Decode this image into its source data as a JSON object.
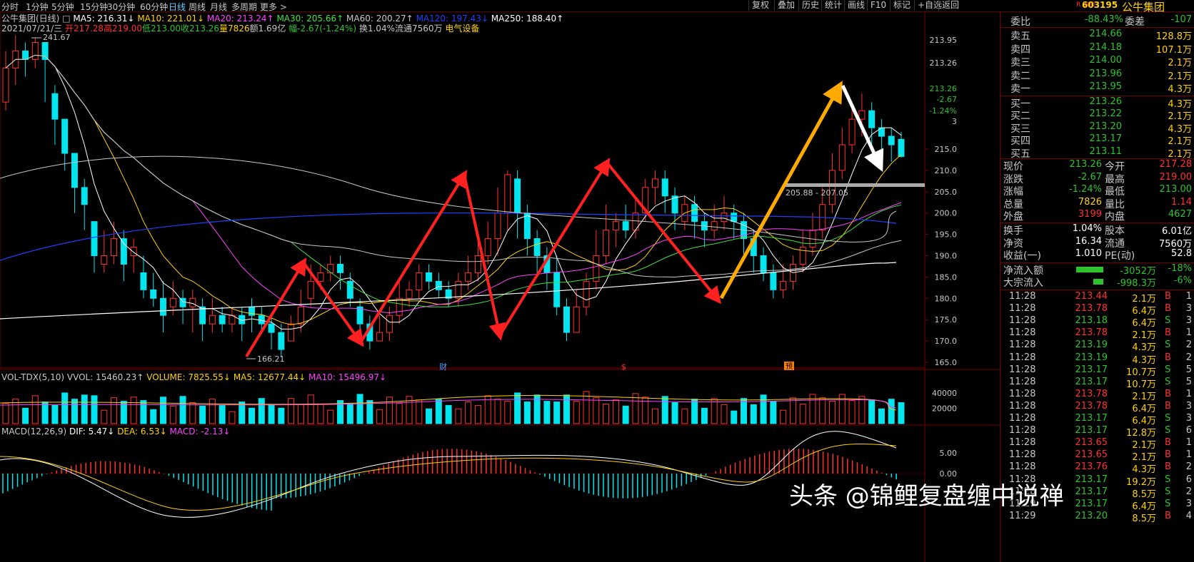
{
  "periods": [
    "分时",
    "1分钟",
    "5分钟",
    "15分钟",
    "30分钟",
    "60分钟",
    "日线",
    "周线",
    "月线",
    "多周期",
    "更多 >"
  ],
  "active_period": "日线",
  "top_buttons": [
    "复权",
    "叠加",
    "历史",
    "统计",
    "画线",
    "F10",
    "标记",
    "+自选",
    "返回"
  ],
  "info": {
    "title": "公牛集团(日线)",
    "ma5": "MA5: 216.31↓",
    "ma10": "MA10: 221.01↓",
    "ma20": "MA20: 213.24↑",
    "ma30": "MA30: 205.66↑",
    "ma60": "MA60: 200.27↑",
    "ma120": "MA120: 197.43↓",
    "ma250": "MA250: 188.40↑",
    "date": "2021/07/21/三",
    "open": "开217.28",
    "high": "高219.00",
    "low": "低213.00",
    "close": "收213.26",
    "vol": "量7826",
    "amount": "额1.69亿",
    "change": "幅-2.67(-1.24%)",
    "turnover": "换1.04%",
    "float": "流通7560万",
    "sector": "电气设备"
  },
  "price_axis": [
    "213.95",
    "213.26",
    "213.26",
    "-2.67",
    "-1.24%",
    "215.0",
    "210.0",
    "205.0",
    "200.0",
    "195.0",
    "190.0",
    "185.0",
    "180.0",
    "175.0",
    "170.0",
    "165.0"
  ],
  "annotations": {
    "high": "241.67",
    "low": "166.21",
    "zone": "205.88 - 207.05",
    "mark_cai": "财",
    "mark_s": "$",
    "mark_yu": "预"
  },
  "vol_info": {
    "title": "VOL-TDX(5,10)",
    "vvol": "VVOL: 15460.23↑",
    "volume": "VOLUME: 7825.55↓",
    "ma5": "MA5: 12677.44↓",
    "ma10": "MA10: 15496.97↓"
  },
  "vol_axis": [
    "40000",
    "20000"
  ],
  "macd_info": {
    "title": "MACD(12,26,9)",
    "dif": "DIF: 5.47↓",
    "dea": "DEA: 6.53↓",
    "macd": "MACD: -2.13↓"
  },
  "macd_axis": [
    "5.00",
    "0.00"
  ],
  "stock": {
    "code": "603195",
    "name": "公牛集团",
    "badge": "R 300"
  },
  "weibi": {
    "label1": "委比",
    "v1": "-88.43%",
    "label2": "委差",
    "v2": "-107"
  },
  "asks": [
    {
      "label": "卖五",
      "price": "214.66",
      "vol": "128.8万"
    },
    {
      "label": "卖四",
      "price": "214.18",
      "vol": "107.1万"
    },
    {
      "label": "卖三",
      "price": "214.00",
      "vol": "2.1万"
    },
    {
      "label": "卖二",
      "price": "213.96",
      "vol": "2.1万"
    },
    {
      "label": "卖一",
      "price": "213.95",
      "vol": "4.3万"
    }
  ],
  "bids": [
    {
      "label": "买一",
      "price": "213.26",
      "vol": "4.3万"
    },
    {
      "label": "买二",
      "price": "213.22",
      "vol": "2.1万"
    },
    {
      "label": "买三",
      "price": "213.20",
      "vol": "4.3万"
    },
    {
      "label": "买四",
      "price": "213.17",
      "vol": "2.1万"
    },
    {
      "label": "买五",
      "price": "213.11",
      "vol": "2.1万"
    }
  ],
  "quote": [
    {
      "l1": "现价",
      "v1": "213.26",
      "c1": "#2dc32d",
      "l2": "今开",
      "v2": "217.28",
      "c2": "#ff3030"
    },
    {
      "l1": "涨跌",
      "v1": "-2.67",
      "c1": "#2dc32d",
      "l2": "最高",
      "v2": "219.00",
      "c2": "#ff3030"
    },
    {
      "l1": "涨幅",
      "v1": "-1.24%",
      "c1": "#2dc32d",
      "l2": "最低",
      "v2": "213.00",
      "c2": "#2dc32d"
    },
    {
      "l1": "总量",
      "v1": "7826",
      "c1": "#ffd200",
      "l2": "量比",
      "v2": "1.14",
      "c2": "#ff3030"
    },
    {
      "l1": "外盘",
      "v1": "3199",
      "c1": "#ff3030",
      "l2": "内盘",
      "v2": "4627",
      "c2": "#2dc32d"
    }
  ],
  "fundamentals": [
    {
      "l1": "换手",
      "v1": "1.04%",
      "l2": "股本",
      "v2": "6.01亿"
    },
    {
      "l1": "净资",
      "v1": "16.34",
      "l2": "流通",
      "v2": "7560万"
    },
    {
      "l1": "收益(一)",
      "v1": "1.010",
      "l2": "PE(动)",
      "v2": "52.8"
    }
  ],
  "flows": [
    {
      "label": "净流入额",
      "value": "-3052万",
      "pct": "-18%",
      "fill": 0.55
    },
    {
      "label": "大宗流入",
      "value": "-998.3万",
      "pct": "-6%",
      "fill": 0.2
    }
  ],
  "ticks": [
    {
      "t": "11:28",
      "p": "213.44",
      "v": "2.1万",
      "d": "B",
      "n": "1"
    },
    {
      "t": "11:28",
      "p": "213.78",
      "v": "6.4万",
      "d": "B",
      "n": "3"
    },
    {
      "t": "11:28",
      "p": "213.18",
      "v": "6.4万",
      "d": "S",
      "n": "3"
    },
    {
      "t": "11:28",
      "p": "213.78",
      "v": "2.1万",
      "d": "B",
      "n": "1"
    },
    {
      "t": "11:28",
      "p": "213.19",
      "v": "4.3万",
      "d": "S",
      "n": "2"
    },
    {
      "t": "11:28",
      "p": "213.19",
      "v": "4.3万",
      "d": "B",
      "n": "2"
    },
    {
      "t": "11:28",
      "p": "213.17",
      "v": "10.7万",
      "d": "S",
      "n": "5"
    },
    {
      "t": "11:28",
      "p": "213.17",
      "v": "10.7万",
      "d": "S",
      "n": "5"
    },
    {
      "t": "11:28",
      "p": "213.78",
      "v": "2.1万",
      "d": "B",
      "n": "1"
    },
    {
      "t": "11:28",
      "p": "213.78",
      "v": "6.4万",
      "d": "B",
      "n": "3"
    },
    {
      "t": "11:28",
      "p": "213.17",
      "v": "6.4万",
      "d": "S",
      "n": "3"
    },
    {
      "t": "11:28",
      "p": "213.17",
      "v": "12.8万",
      "d": "S",
      "n": "6"
    },
    {
      "t": "11:28",
      "p": "213.65",
      "v": "2.1万",
      "d": "B",
      "n": "1"
    },
    {
      "t": "11:28",
      "p": "213.65",
      "v": "2.1万",
      "d": "B",
      "n": "1"
    },
    {
      "t": "11:28",
      "p": "213.76",
      "v": "4.3万",
      "d": "B",
      "n": "2"
    },
    {
      "t": "11:28",
      "p": "213.17",
      "v": "19.2万",
      "d": "S",
      "n": "6"
    },
    {
      "t": "11:28",
      "p": "213.17",
      "v": "8.5万",
      "d": "S",
      "n": "2"
    },
    {
      "t": "11:29",
      "p": "213.17",
      "v": "6.4万",
      "d": "S",
      "n": "3"
    },
    {
      "t": "11:29",
      "p": "213.20",
      "v": "8.5万",
      "d": "B",
      "n": "4"
    }
  ],
  "watermark": "头条 @锦鲤复盘缠中说禅"
}
